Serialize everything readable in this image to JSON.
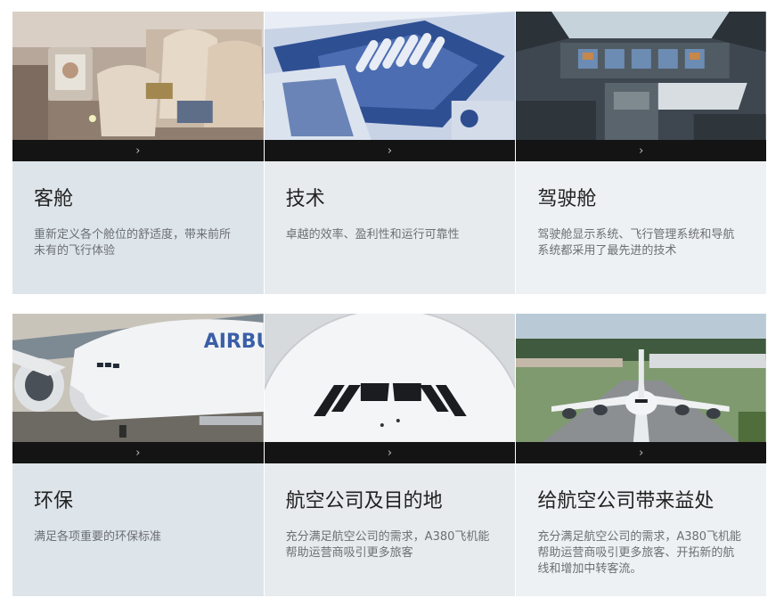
{
  "arrow_icon": "chevron-right-icon",
  "arrow_glyph": "›",
  "cards": [
    {
      "title": "客舱",
      "desc": "重新定义各个舱位的舒适度，带来前所未有的飞行体验",
      "image": "cabin-seats-photo"
    },
    {
      "title": "技术",
      "desc": "卓越的效率、盈利性和运行可靠性",
      "image": "engine-technology-photo"
    },
    {
      "title": "驾驶舱",
      "desc": "驾驶舱显示系统、飞行管理系统和导航系统都采用了最先进的技术",
      "image": "cockpit-photo"
    },
    {
      "title": "环保",
      "desc": "满足各项重要的环保标准",
      "image": "aircraft-side-photo"
    },
    {
      "title": "航空公司及目的地",
      "desc": "充分满足航空公司的需求，A380飞机能帮助运营商吸引更多旅客",
      "image": "aircraft-nose-photo"
    },
    {
      "title": "给航空公司带来益处",
      "desc": "充分满足航空公司的需求，A380飞机能帮助运营商吸引更多旅客、开拓新的航线和增加中转客流。",
      "image": "aircraft-runway-photo"
    }
  ],
  "photo_text": {
    "airbus": "AIRBUS"
  }
}
